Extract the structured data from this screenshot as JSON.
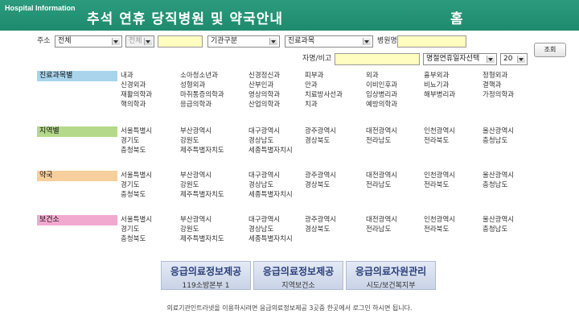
{
  "header": {
    "small_title": "Hospital Information",
    "title": "추석 연휴 당직병원 및 약국안내",
    "home": "홈"
  },
  "form": {
    "address_label": "주소",
    "region1": "전체",
    "region2": "전체",
    "agency_type": "기관구분",
    "department": "진료과목",
    "hospital_name_label": "병원명",
    "name_remark_label": "자명/비고",
    "date_select": "명절연휴일자선택",
    "count_select": "20",
    "search_button": "조회"
  },
  "sections": [
    {
      "label": "진료과목별",
      "color": "#a9d4ec",
      "rows": [
        [
          "내과",
          "소아청소년과",
          "신경정신과",
          "피부과",
          "외과",
          "흉부외과",
          "정형외과"
        ],
        [
          "신경외과",
          "성형외과",
          "산부인과",
          "안과",
          "이비인후과",
          "비뇨기과",
          "결핵과"
        ],
        [
          "재활의학과",
          "마취통증의학과",
          "영상의학과",
          "치료방사선과",
          "임상병리과",
          "해부병리과",
          "가정의학과"
        ],
        [
          "핵의학과",
          "응급의학과",
          "산업의학과",
          "치과",
          "예방의학과",
          "",
          ""
        ]
      ]
    },
    {
      "label": "지역별",
      "color": "#b4d98a",
      "rows": [
        [
          "서울특별시",
          "부산광역시",
          "대구광역시",
          "광주광역시",
          "대전광역시",
          "인천광역시",
          "울산광역시"
        ],
        [
          "경기도",
          "강원도",
          "경상남도",
          "경상북도",
          "전라남도",
          "전라북도",
          "충청남도"
        ],
        [
          "충청북도",
          "제주특별자치도",
          "세종특별자치시",
          "",
          "",
          "",
          ""
        ]
      ]
    },
    {
      "label": "약국",
      "color": "#f7cf9c",
      "rows": [
        [
          "서울특별시",
          "부산광역시",
          "대구광역시",
          "광주광역시",
          "대전광역시",
          "인천광역시",
          "울산광역시"
        ],
        [
          "경기도",
          "강원도",
          "경상남도",
          "경상북도",
          "전라남도",
          "전라북도",
          "충청남도"
        ],
        [
          "충청북도",
          "제주특별자치도",
          "세종특별자치시",
          "",
          "",
          "",
          ""
        ]
      ]
    },
    {
      "label": "보건소",
      "color": "#f2a9cf",
      "rows": [
        [
          "서울특별시",
          "부산광역시",
          "대구광역시",
          "광주광역시",
          "대전광역시",
          "인천광역시",
          "울산광역시"
        ],
        [
          "경기도",
          "강원도",
          "경상남도",
          "경상북도",
          "전라남도",
          "전라북도",
          "충청남도"
        ],
        [
          "충청북도",
          "제주특별자치도",
          "세종특별자치시",
          "",
          "",
          "",
          ""
        ]
      ]
    }
  ],
  "bottom_buttons": [
    {
      "line1": "응급의료정보제공",
      "line2": "119소방본부 1"
    },
    {
      "line1": "응급의료정보제공",
      "line2": "지역보건소"
    },
    {
      "line1": "응급의료자원관리",
      "line2": "시도/보건복지부"
    }
  ],
  "footer": "의료기관인트라넷을 이용하시려면 응급의료정보제공 3곳중 한곳에서 로그인 하시면 됩니다."
}
